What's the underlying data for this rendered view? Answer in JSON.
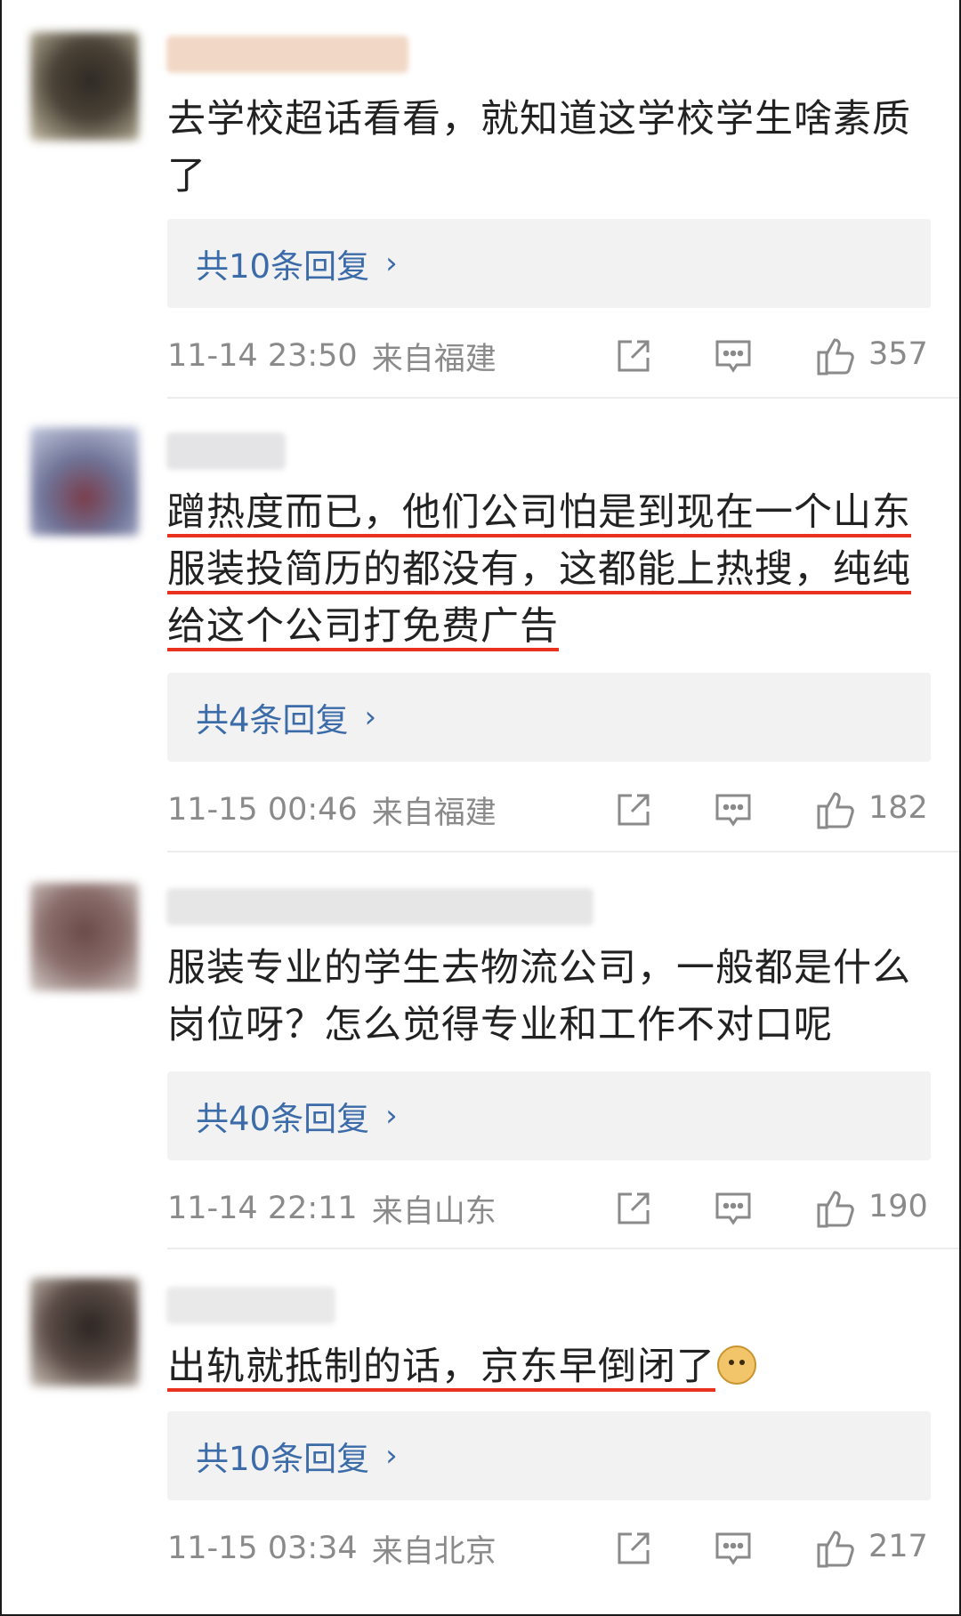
{
  "comments": [
    {
      "content": "去学校超话看看，就知道这学校学生啥素质了",
      "highlight": false,
      "emoji": "",
      "replies": "共10条回复",
      "time": "11-14 23:50",
      "location": "来自福建",
      "likes": "357",
      "avatar_color": "#4a4236",
      "name_color": "#f1d8c6"
    },
    {
      "content": "蹭热度而已，他们公司怕是到现在一个山东服装投简历的都没有，这都能上热搜，纯纯给这个公司打免费广告",
      "highlight": true,
      "emoji": "",
      "replies": "共4条回复",
      "time": "11-15 00:46",
      "location": "来自福建",
      "likes": "182",
      "avatar_color": "#6f7397",
      "name_color": "#e4e4e6"
    },
    {
      "content": "服装专业的学生去物流公司，一般都是什么岗位呀？怎么觉得专业和工作不对口呢",
      "highlight": false,
      "emoji": "",
      "replies": "共40条回复",
      "time": "11-14 22:11",
      "location": "来自山东",
      "likes": "190",
      "avatar_color": "#8a6e6c",
      "name_color": "#e6e6e6"
    },
    {
      "content": "出轨就抵制的话，京东早倒闭了",
      "highlight": true,
      "emoji": "doge-emoji",
      "replies": "共10条回复",
      "time": "11-15 03:34",
      "location": "来自北京",
      "likes": "217",
      "avatar_color": "#5a4b45",
      "name_color": "#e9e9e9"
    }
  ],
  "icons": {
    "share": "share-icon",
    "comment": "comment-icon",
    "like": "thumbs-up-icon",
    "chevron": "chevron-right-icon"
  },
  "colors": {
    "link": "#3b6ba8",
    "underline": "#e8321f",
    "meta": "#8a8a8a"
  }
}
